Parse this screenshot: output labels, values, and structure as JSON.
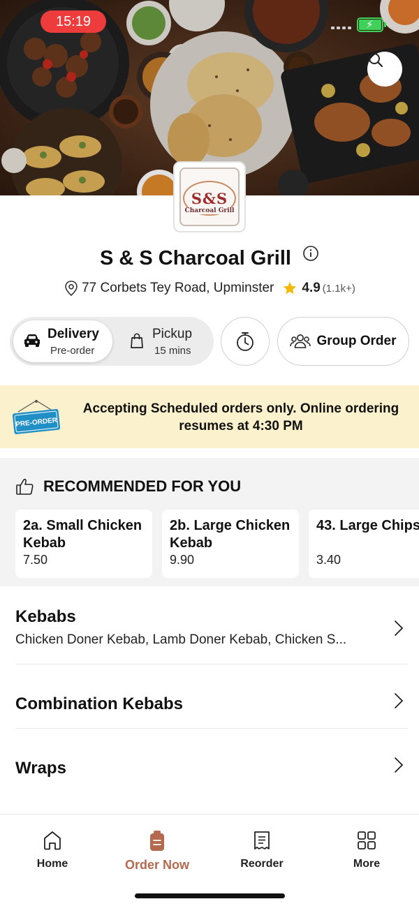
{
  "status_bar": {
    "time": "15:19"
  },
  "colors": {
    "accent": "#b46a4f",
    "banner_bg": "#fbf2cd",
    "time_pill": "#ee3b3b",
    "battery": "#3fd15a",
    "star": "#f5b800"
  },
  "restaurant": {
    "logo_text": "S&S",
    "logo_subtext": "Charcoal Grill",
    "name": "S & S Charcoal Grill",
    "address": "77 Corbets Tey Road, Upminster",
    "rating": "4.9",
    "rating_count": "(1.1k+)"
  },
  "order_modes": {
    "delivery_label": "Delivery",
    "delivery_sub": "Pre-order",
    "pickup_label": "Pickup",
    "pickup_sub": "15 mins",
    "group_order_label": "Group Order"
  },
  "banner": {
    "sign_text": "PRE-ORDER",
    "message": "Accepting Scheduled orders only. Online ordering resumes at 4:30 PM"
  },
  "recommended": {
    "heading": "RECOMMENDED FOR YOU",
    "items": [
      {
        "name": "2a. Small Chicken Kebab",
        "price": "7.50"
      },
      {
        "name": "2b. Large Chicken Kebab",
        "price": "9.90"
      },
      {
        "name": "43. Large Chips",
        "price": "3.40"
      }
    ]
  },
  "categories": [
    {
      "name": "Kebabs",
      "description": "Chicken Doner Kebab, Lamb Doner Kebab, Chicken S..."
    },
    {
      "name": "Combination Kebabs",
      "description": ""
    },
    {
      "name": "Wraps",
      "description": ""
    }
  ],
  "bottom_nav": [
    {
      "label": "Home",
      "icon": "home-icon"
    },
    {
      "label": "Order Now",
      "icon": "order-icon"
    },
    {
      "label": "Reorder",
      "icon": "receipt-icon"
    },
    {
      "label": "More",
      "icon": "grid-icon"
    }
  ]
}
